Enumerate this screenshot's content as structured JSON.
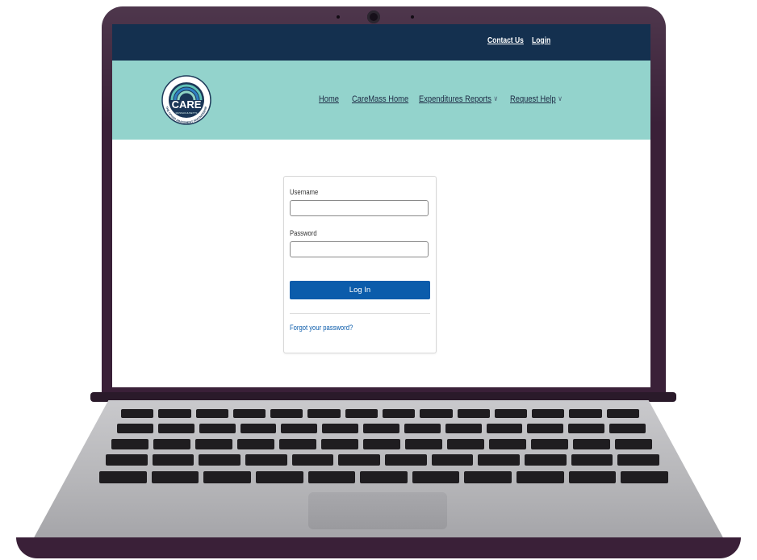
{
  "header": {
    "contact_label": "Contact Us",
    "login_label": "Login"
  },
  "logo": {
    "name": "CARE",
    "tagline": "MASSACHUSETTS",
    "arc_text": "THE OPIOID ABATEMENT PARTNERSHIP"
  },
  "nav": {
    "items": [
      {
        "label": "Home",
        "dropdown": false
      },
      {
        "label": "CareMass Home",
        "dropdown": false
      },
      {
        "label": "Expenditures Reports",
        "dropdown": true
      },
      {
        "label": "Request Help",
        "dropdown": true
      }
    ]
  },
  "login_form": {
    "username_label": "Username",
    "username_value": "",
    "password_label": "Password",
    "password_value": "",
    "submit_label": "Log In",
    "forgot_label": "Forgot your password?"
  },
  "colors": {
    "laptop_frame": "#3a2038",
    "topbar": "#14304f",
    "navbar": "#93d3cc",
    "primary_button": "#0b5cab"
  },
  "icons": {
    "dropdown": "chevron-down-icon",
    "camera": "webcam-icon"
  }
}
